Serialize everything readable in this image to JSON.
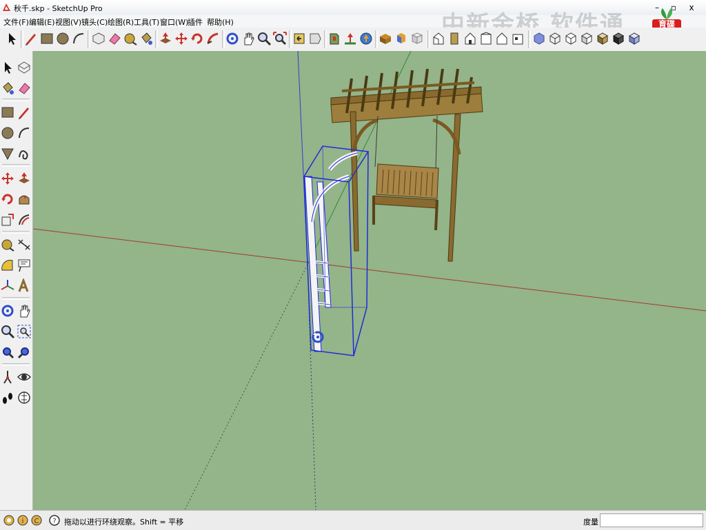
{
  "window": {
    "title": "秋千.skp - SketchUp Pro",
    "minimize": "–",
    "maximize": "▫",
    "close": "x"
  },
  "menu": [
    "文件(F)",
    "编辑(E)",
    "视图(V)",
    "镜头(C)",
    "绘图(R)",
    "工具(T)",
    "窗口(W)",
    "插件",
    "帮助(H)"
  ],
  "overlay": {
    "watermark": "中新金桥 软件通",
    "logo": "育碟\n软件"
  },
  "status": {
    "hint": "拖动以进行环绕观察。Shift = 平移",
    "measure_label": "度量",
    "measure_value": ""
  },
  "colors": {
    "viewport_bg": "#94b48a",
    "selection_blue": "#1f2bd6",
    "wood": "#8a6a2f",
    "axis_red": "#c0392b",
    "axis_green": "#2e8b3a",
    "axis_blue": "#2c3fd1"
  },
  "toolbar_icons": [
    "select-icon",
    "pencil-icon",
    "rectangle-icon",
    "circle-icon",
    "arc-icon",
    "make-component-icon",
    "eraser-icon",
    "tape-measure-icon",
    "paint-bucket-icon",
    "push-pull-icon",
    "move-icon",
    "rotate-icon",
    "follow-me-icon",
    "orbit-icon",
    "pan-icon",
    "zoom-icon",
    "zoom-extents-icon",
    "previous-view-icon",
    "next-view-icon",
    "add-location-icon",
    "toggle-terrain-icon",
    "get-models-icon",
    "share-model-icon",
    "share-component-icon",
    "iso-view-icon",
    "top-view-icon",
    "front-view-icon",
    "right-view-icon",
    "back-view-icon",
    "left-view-icon",
    "xray-icon",
    "wireframe-icon",
    "hidden-line-icon",
    "shaded-icon",
    "shaded-texture-icon",
    "monochrome-icon"
  ],
  "left_icons": [
    "select-icon",
    "make-component-icon",
    "paint-bucket-icon",
    "eraser-icon",
    "rectangle-icon",
    "pencil-icon",
    "circle-icon",
    "arc-icon",
    "polygon-icon",
    "freehand-icon",
    "move-icon",
    "push-pull-icon",
    "rotate-icon",
    "follow-me-icon",
    "scale-icon",
    "offset-icon",
    "tape-measure-icon",
    "dimension-icon",
    "protractor-icon",
    "text-icon",
    "axes-icon",
    "3d-text-icon",
    "orbit-icon",
    "pan-icon",
    "zoom-icon",
    "zoom-window-icon",
    "zoom-extents-icon",
    "previous-icon",
    "position-camera-icon",
    "look-around-icon",
    "walk-icon",
    "section-plane-icon"
  ]
}
